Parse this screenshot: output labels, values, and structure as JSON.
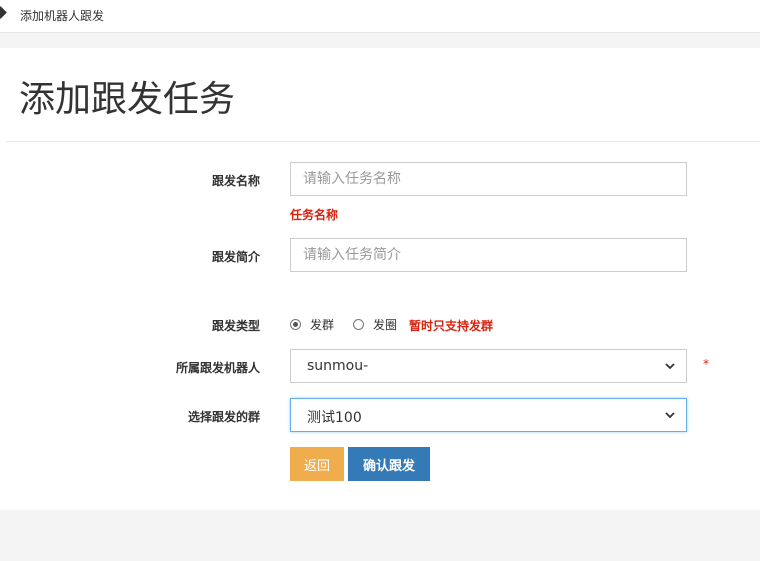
{
  "breadcrumb": {
    "label": "添加机器人跟发"
  },
  "page": {
    "title": "添加跟发任务"
  },
  "form": {
    "name": {
      "label": "跟发名称",
      "placeholder": "请输入任务名称",
      "error": "任务名称"
    },
    "intro": {
      "label": "跟发简介",
      "placeholder": "请输入任务简介"
    },
    "type": {
      "label": "跟发类型",
      "options": [
        {
          "label": "发群",
          "checked": true
        },
        {
          "label": "发圈",
          "checked": false
        }
      ],
      "note": "暂时只支持发群"
    },
    "robot": {
      "label": "所属跟发机器人",
      "value": "sunmou-",
      "required_mark": "*"
    },
    "group": {
      "label": "选择跟发的群",
      "value": "测试100"
    }
  },
  "buttons": {
    "back": "返回",
    "confirm": "确认跟发"
  },
  "colors": {
    "back": "#f0ad4e",
    "confirm": "#337ab7",
    "error": "#d9230f",
    "focus": "#66afe9"
  }
}
